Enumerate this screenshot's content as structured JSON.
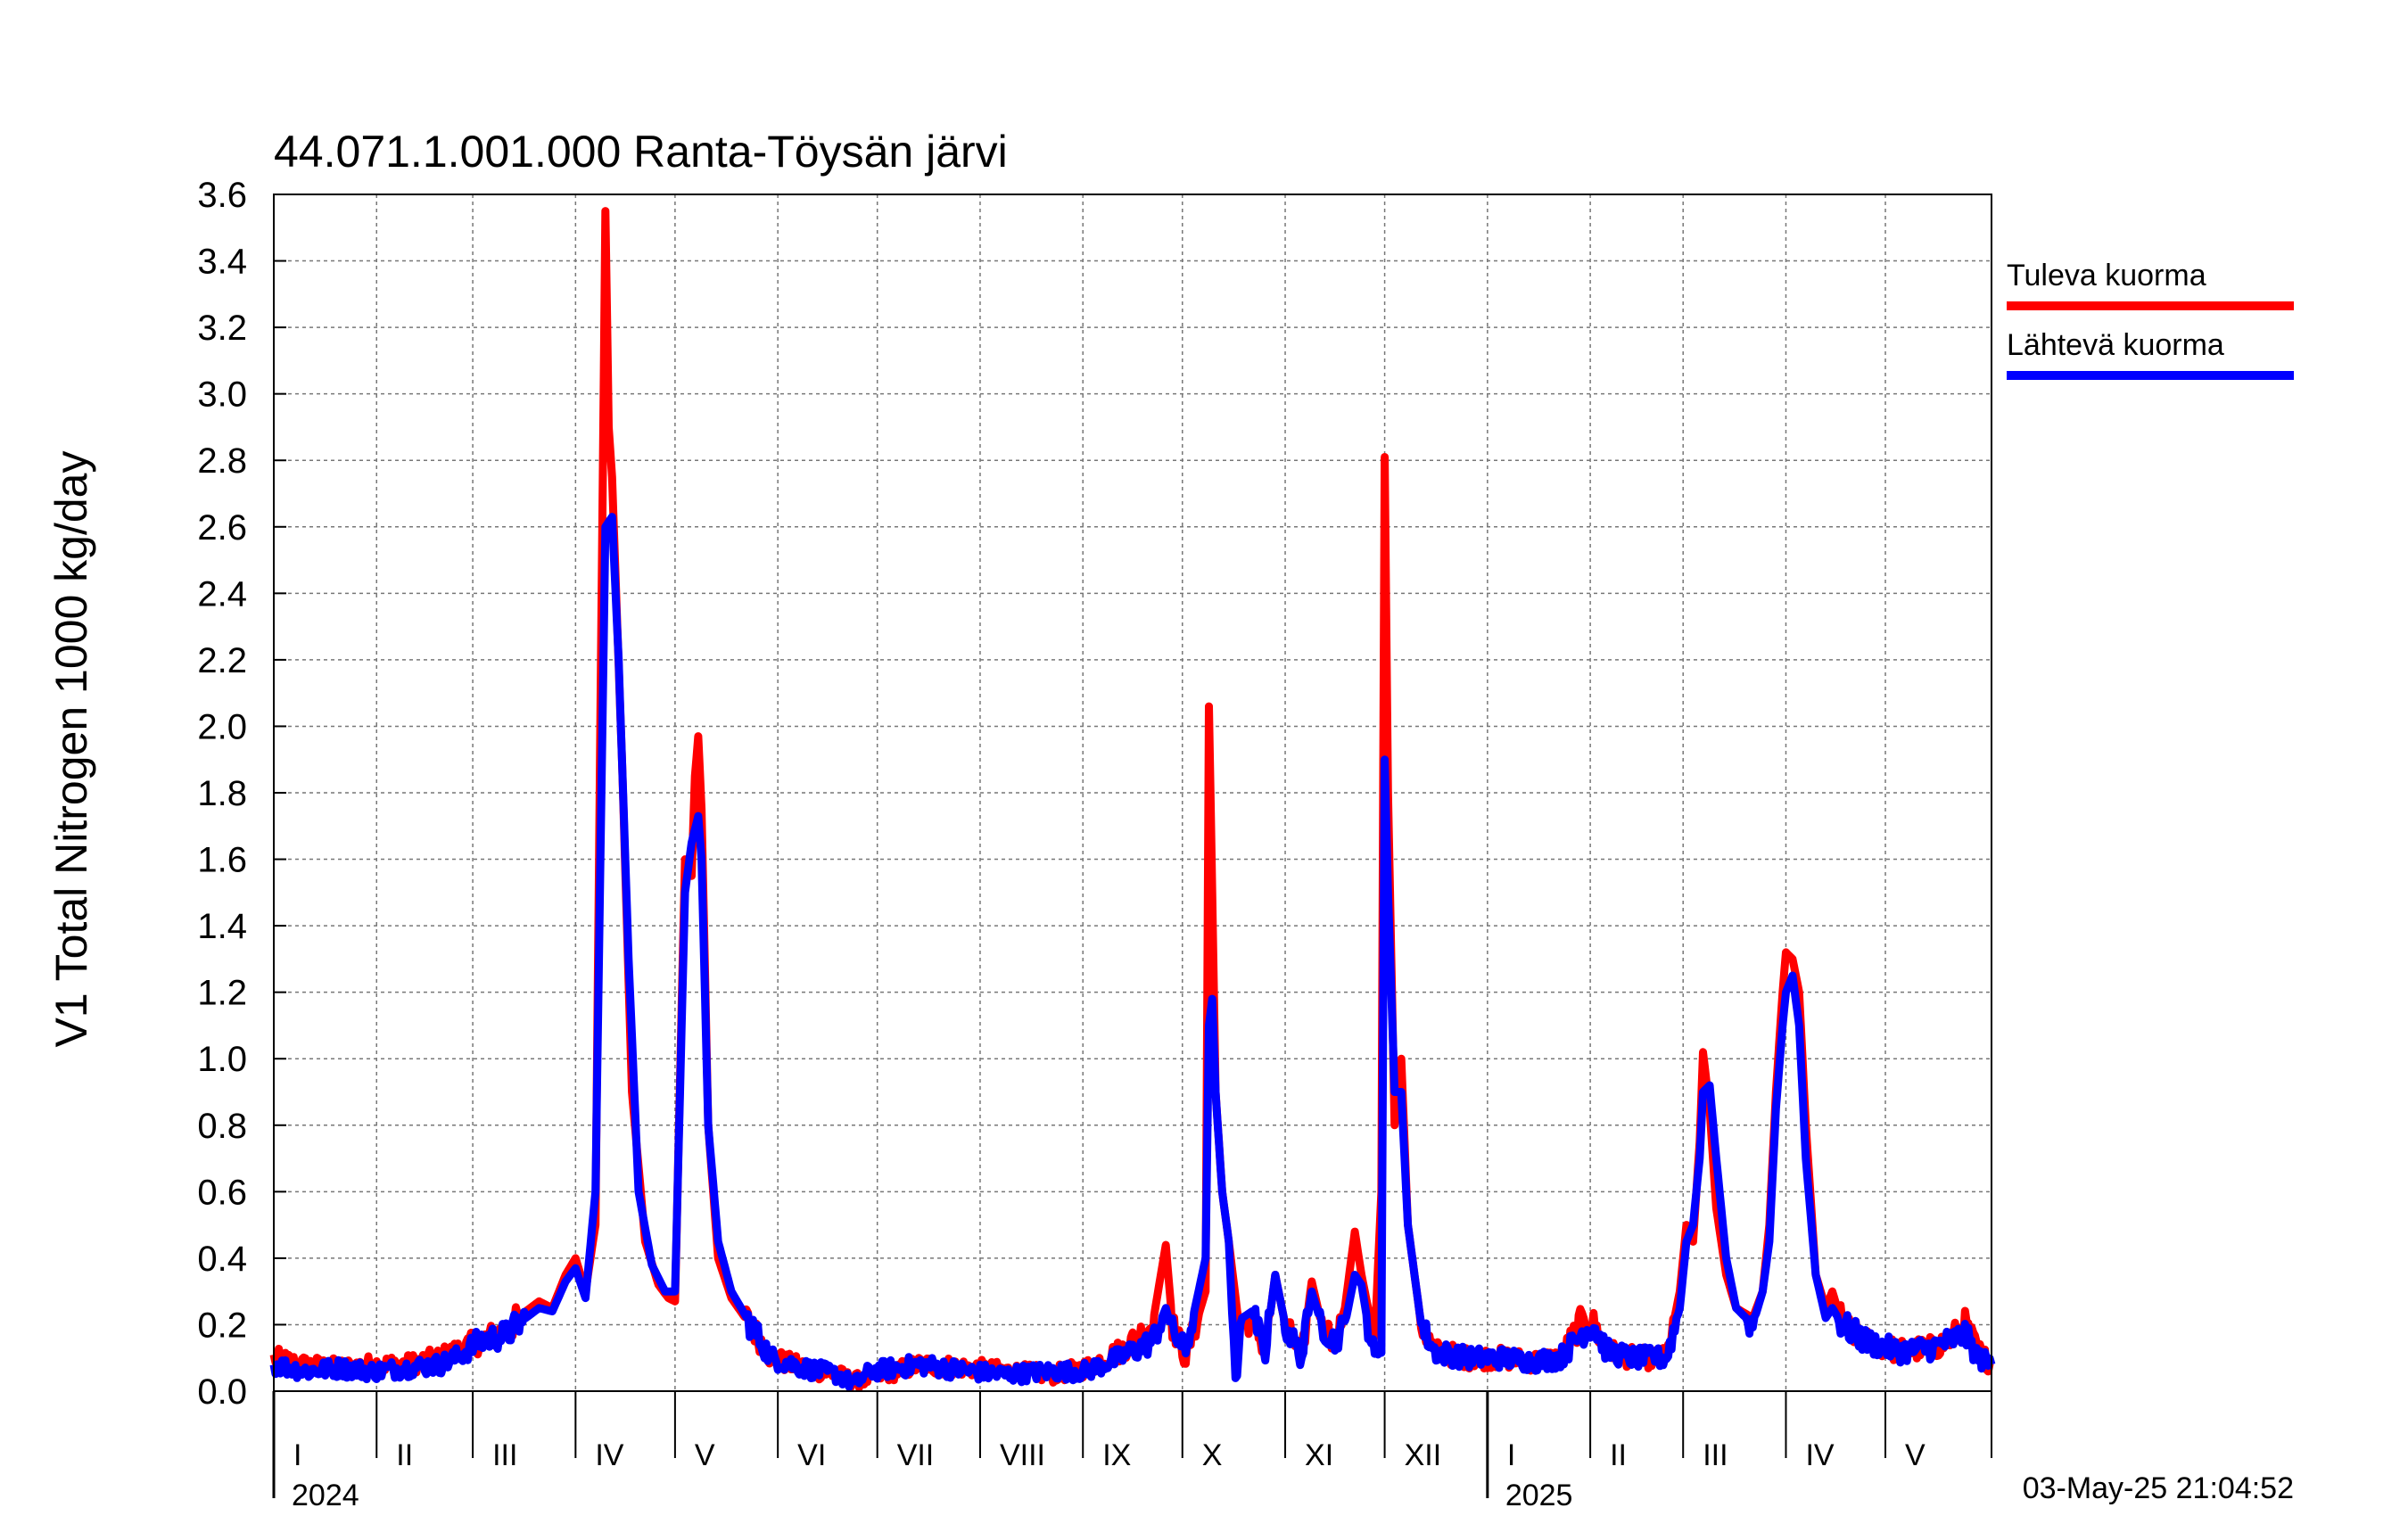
{
  "chart_data": {
    "type": "line",
    "title": "44.071.1.001.000 Ranta-Töysän järvi",
    "ylabel": "V1 Total Nitrogen 1000 kg/day",
    "ylim": [
      0,
      3.6
    ],
    "yticks": [
      "0.0",
      "0.2",
      "0.4",
      "0.6",
      "0.8",
      "1.0",
      "1.2",
      "1.4",
      "1.6",
      "1.8",
      "2.0",
      "2.2",
      "2.4",
      "2.6",
      "2.8",
      "3.0",
      "3.2",
      "3.4",
      "3.6"
    ],
    "x_range_days": [
      0,
      518
    ],
    "months": [
      {
        "label": "I",
        "start": 0
      },
      {
        "label": "II",
        "start": 31
      },
      {
        "label": "III",
        "start": 60
      },
      {
        "label": "IV",
        "start": 91
      },
      {
        "label": "V",
        "start": 121
      },
      {
        "label": "VI",
        "start": 152
      },
      {
        "label": "VII",
        "start": 182
      },
      {
        "label": "VIII",
        "start": 213
      },
      {
        "label": "IX",
        "start": 244
      },
      {
        "label": "X",
        "start": 274
      },
      {
        "label": "XI",
        "start": 305
      },
      {
        "label": "XII",
        "start": 335
      },
      {
        "label": "I",
        "start": 366
      },
      {
        "label": "II",
        "start": 397
      },
      {
        "label": "III",
        "start": 425
      },
      {
        "label": "IV",
        "start": 456
      },
      {
        "label": "V",
        "start": 486
      }
    ],
    "years": [
      {
        "label": "2024",
        "start": 0
      },
      {
        "label": "2025",
        "start": 366
      }
    ],
    "grid": true,
    "legend_position": "right",
    "series": [
      {
        "name": "Tuleva kuorma",
        "color": "#ff0000",
        "points": [
          [
            0,
            0.1
          ],
          [
            8,
            0.08
          ],
          [
            20,
            0.07
          ],
          [
            30,
            0.08
          ],
          [
            40,
            0.08
          ],
          [
            50,
            0.1
          ],
          [
            55,
            0.12
          ],
          [
            62,
            0.15
          ],
          [
            70,
            0.18
          ],
          [
            76,
            0.24
          ],
          [
            80,
            0.27
          ],
          [
            84,
            0.25
          ],
          [
            88,
            0.35
          ],
          [
            91,
            0.4
          ],
          [
            94,
            0.3
          ],
          [
            97,
            0.5
          ],
          [
            100,
            3.55
          ],
          [
            101,
            2.9
          ],
          [
            102,
            2.75
          ],
          [
            105,
            1.9
          ],
          [
            108,
            0.9
          ],
          [
            112,
            0.45
          ],
          [
            116,
            0.32
          ],
          [
            119,
            0.28
          ],
          [
            121,
            0.27
          ],
          [
            124,
            1.6
          ],
          [
            126,
            1.55
          ],
          [
            127,
            1.85
          ],
          [
            128,
            1.97
          ],
          [
            129,
            1.75
          ],
          [
            131,
            0.8
          ],
          [
            134,
            0.4
          ],
          [
            138,
            0.28
          ],
          [
            145,
            0.18
          ],
          [
            150,
            0.1
          ],
          [
            160,
            0.07
          ],
          [
            170,
            0.05
          ],
          [
            175,
            0.03
          ],
          [
            180,
            0.04
          ],
          [
            195,
            0.08
          ],
          [
            210,
            0.07
          ],
          [
            220,
            0.06
          ],
          [
            235,
            0.05
          ],
          [
            245,
            0.07
          ],
          [
            255,
            0.12
          ],
          [
            265,
            0.2
          ],
          [
            269,
            0.44
          ],
          [
            271,
            0.2
          ],
          [
            275,
            0.1
          ],
          [
            281,
            0.3
          ],
          [
            282,
            2.06
          ],
          [
            283,
            1.5
          ],
          [
            284,
            0.9
          ],
          [
            286,
            0.6
          ],
          [
            288,
            0.45
          ],
          [
            291,
            0.2
          ],
          [
            295,
            0.22
          ],
          [
            299,
            0.12
          ],
          [
            302,
            0.35
          ],
          [
            305,
            0.2
          ],
          [
            310,
            0.1
          ],
          [
            313,
            0.33
          ],
          [
            316,
            0.2
          ],
          [
            320,
            0.15
          ],
          [
            323,
            0.25
          ],
          [
            326,
            0.48
          ],
          [
            328,
            0.35
          ],
          [
            330,
            0.25
          ],
          [
            332,
            0.15
          ],
          [
            334,
            0.6
          ],
          [
            335,
            2.81
          ],
          [
            336,
            1.8
          ],
          [
            338,
            0.8
          ],
          [
            340,
            1.0
          ],
          [
            342,
            0.5
          ],
          [
            346,
            0.2
          ],
          [
            350,
            0.12
          ],
          [
            360,
            0.1
          ],
          [
            370,
            0.1
          ],
          [
            380,
            0.09
          ],
          [
            388,
            0.1
          ],
          [
            395,
            0.22
          ],
          [
            398,
            0.2
          ],
          [
            402,
            0.12
          ],
          [
            410,
            0.1
          ],
          [
            420,
            0.1
          ],
          [
            424,
            0.3
          ],
          [
            426,
            0.5
          ],
          [
            428,
            0.45
          ],
          [
            430,
            0.75
          ],
          [
            431,
            1.02
          ],
          [
            433,
            0.85
          ],
          [
            435,
            0.55
          ],
          [
            438,
            0.35
          ],
          [
            441,
            0.25
          ],
          [
            446,
            0.22
          ],
          [
            449,
            0.3
          ],
          [
            451,
            0.5
          ],
          [
            453,
            0.9
          ],
          [
            455,
            1.2
          ],
          [
            456,
            1.32
          ],
          [
            458,
            1.3
          ],
          [
            460,
            1.2
          ],
          [
            462,
            0.8
          ],
          [
            465,
            0.35
          ],
          [
            468,
            0.25
          ],
          [
            470,
            0.3
          ],
          [
            473,
            0.2
          ],
          [
            480,
            0.15
          ],
          [
            490,
            0.12
          ],
          [
            500,
            0.13
          ],
          [
            505,
            0.15
          ],
          [
            510,
            0.2
          ],
          [
            514,
            0.12
          ],
          [
            518,
            0.08
          ]
        ]
      },
      {
        "name": "Lähtevä kuorma",
        "color": "#0000ff",
        "points": [
          [
            0,
            0.08
          ],
          [
            10,
            0.06
          ],
          [
            20,
            0.07
          ],
          [
            30,
            0.06
          ],
          [
            40,
            0.07
          ],
          [
            50,
            0.08
          ],
          [
            55,
            0.1
          ],
          [
            62,
            0.15
          ],
          [
            70,
            0.17
          ],
          [
            76,
            0.22
          ],
          [
            80,
            0.25
          ],
          [
            84,
            0.24
          ],
          [
            88,
            0.33
          ],
          [
            91,
            0.37
          ],
          [
            94,
            0.28
          ],
          [
            97,
            0.6
          ],
          [
            100,
            2.6
          ],
          [
            102,
            2.63
          ],
          [
            104,
            2.2
          ],
          [
            107,
            1.3
          ],
          [
            110,
            0.6
          ],
          [
            114,
            0.38
          ],
          [
            118,
            0.3
          ],
          [
            121,
            0.3
          ],
          [
            124,
            1.5
          ],
          [
            126,
            1.65
          ],
          [
            128,
            1.73
          ],
          [
            129,
            1.6
          ],
          [
            131,
            0.8
          ],
          [
            134,
            0.45
          ],
          [
            138,
            0.3
          ],
          [
            145,
            0.18
          ],
          [
            150,
            0.1
          ],
          [
            160,
            0.07
          ],
          [
            170,
            0.05
          ],
          [
            175,
            0.02
          ],
          [
            180,
            0.06
          ],
          [
            195,
            0.08
          ],
          [
            210,
            0.06
          ],
          [
            220,
            0.05
          ],
          [
            235,
            0.06
          ],
          [
            245,
            0.06
          ],
          [
            255,
            0.1
          ],
          [
            265,
            0.15
          ],
          [
            269,
            0.25
          ],
          [
            271,
            0.18
          ],
          [
            275,
            0.12
          ],
          [
            281,
            0.4
          ],
          [
            282,
            1.1
          ],
          [
            283,
            1.18
          ],
          [
            284,
            0.9
          ],
          [
            286,
            0.6
          ],
          [
            288,
            0.45
          ],
          [
            290,
            0.02
          ],
          [
            292,
            0.22
          ],
          [
            295,
            0.24
          ],
          [
            299,
            0.12
          ],
          [
            302,
            0.35
          ],
          [
            305,
            0.2
          ],
          [
            310,
            0.1
          ],
          [
            313,
            0.3
          ],
          [
            316,
            0.2
          ],
          [
            320,
            0.15
          ],
          [
            323,
            0.2
          ],
          [
            326,
            0.35
          ],
          [
            328,
            0.32
          ],
          [
            330,
            0.2
          ],
          [
            332,
            0.1
          ],
          [
            334,
            0.15
          ],
          [
            335,
            1.9
          ],
          [
            336,
            1.5
          ],
          [
            338,
            0.9
          ],
          [
            340,
            0.9
          ],
          [
            342,
            0.5
          ],
          [
            346,
            0.2
          ],
          [
            350,
            0.12
          ],
          [
            360,
            0.1
          ],
          [
            370,
            0.1
          ],
          [
            380,
            0.09
          ],
          [
            388,
            0.1
          ],
          [
            395,
            0.18
          ],
          [
            398,
            0.2
          ],
          [
            402,
            0.12
          ],
          [
            410,
            0.1
          ],
          [
            420,
            0.1
          ],
          [
            424,
            0.25
          ],
          [
            426,
            0.45
          ],
          [
            428,
            0.5
          ],
          [
            430,
            0.7
          ],
          [
            431,
            0.9
          ],
          [
            433,
            0.92
          ],
          [
            435,
            0.7
          ],
          [
            438,
            0.4
          ],
          [
            441,
            0.25
          ],
          [
            446,
            0.2
          ],
          [
            449,
            0.3
          ],
          [
            451,
            0.45
          ],
          [
            453,
            0.85
          ],
          [
            455,
            1.1
          ],
          [
            456,
            1.2
          ],
          [
            458,
            1.25
          ],
          [
            460,
            1.1
          ],
          [
            462,
            0.7
          ],
          [
            465,
            0.35
          ],
          [
            468,
            0.22
          ],
          [
            470,
            0.25
          ],
          [
            473,
            0.2
          ],
          [
            480,
            0.15
          ],
          [
            490,
            0.12
          ],
          [
            500,
            0.13
          ],
          [
            505,
            0.15
          ],
          [
            510,
            0.17
          ],
          [
            514,
            0.1
          ],
          [
            518,
            0.08
          ]
        ]
      }
    ],
    "timestamp": "03-May-25 21:04:52"
  }
}
